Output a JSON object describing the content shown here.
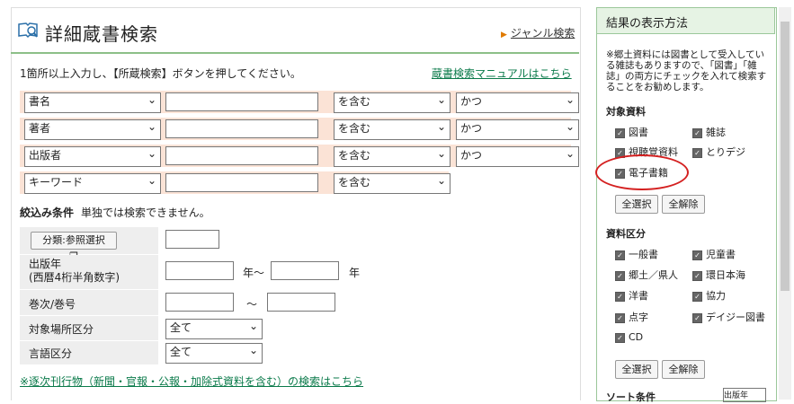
{
  "title": "詳細蔵書検索",
  "genre_link": "ジャンル検索",
  "instruction": "1箇所以上入力し、【所蔵検索】ボタンを押してください。",
  "manual_link": "蔵書検索マニュアルはこちら",
  "search_rows": [
    {
      "field": "書名",
      "match": "を含む",
      "logic": "かつ"
    },
    {
      "field": "著者",
      "match": "を含む",
      "logic": "かつ"
    },
    {
      "field": "出版者",
      "match": "を含む",
      "logic": "かつ"
    },
    {
      "field": "キーワード",
      "match": "を含む"
    }
  ],
  "filter": {
    "label": "絞込み条件",
    "note": "単独では検索できません。"
  },
  "conditions": {
    "category_button": "分類:参照選択",
    "pub_year_label_1": "出版年",
    "pub_year_label_2": "(西暦4桁半角数字)",
    "year_from_suffix": "年～",
    "year_to_suffix": "年",
    "volume_label": "巻次/巻号",
    "tilde": "～",
    "location_label": "対象場所区分",
    "location_value": "全て",
    "language_label": "言語区分",
    "language_value": "全て"
  },
  "serial_link": "※逐次刊行物（新聞・官報・公報・加除式資料を含む）の検索はこちら",
  "side": {
    "title": "結果の表示方法",
    "note": "※郷土資料には図書として受入している雑誌もありますので、「図書」「雑誌」の両方にチェックを入れて検索することをお勧めします。",
    "target_label": "対象資料",
    "targets": [
      "図書",
      "雑誌",
      "視聴覚資料",
      "とりデジ",
      "電子書籍"
    ],
    "select_all": "全選択",
    "clear_all": "全解除",
    "category_label": "資料区分",
    "categories": [
      "一般書",
      "児童書",
      "郷土／県人",
      "環日本海",
      "洋書",
      "協力",
      "点字",
      "デイジー図書",
      "CD"
    ],
    "select_all_2": "全選択",
    "clear_all_2": "全解除",
    "sort_label": "ソート条件",
    "sort_value": "出版年"
  },
  "colors": {
    "accent_green": "#8cbf88",
    "row_bg": "#fbe3d6",
    "link": "#0a7a4a",
    "highlight_circle": "#d42020"
  }
}
